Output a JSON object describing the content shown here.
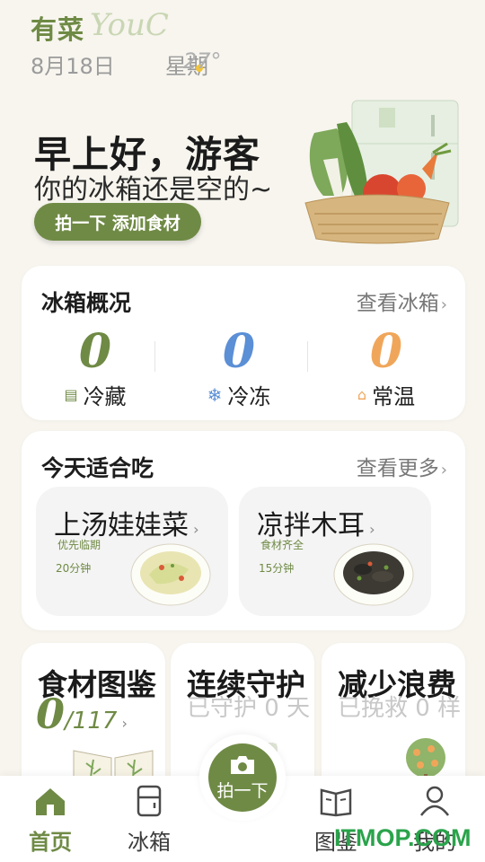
{
  "header": {
    "brand": "有菜",
    "brand_script": "YouC",
    "date": "8月18日",
    "weekday": "星期",
    "temperature": "27°"
  },
  "hero": {
    "greeting": "早上好，游客",
    "status": "你的冰箱还是空的~",
    "photo_button": "拍一下 添加食材"
  },
  "fridge": {
    "title": "冰箱概况",
    "link": "查看冰箱",
    "stats": [
      {
        "value": "0",
        "label": "冷藏",
        "icon": "fridge-icon",
        "color": "#6f8a45"
      },
      {
        "value": "0",
        "label": "冷冻",
        "icon": "snowflake-icon",
        "color": "#5b8fd6"
      },
      {
        "value": "0",
        "label": "常温",
        "icon": "house-icon",
        "color": "#f0a65a"
      }
    ]
  },
  "today": {
    "title": "今天适合吃",
    "link": "查看更多",
    "recipes": [
      {
        "name": "上汤娃娃菜",
        "tag": "优先临期",
        "time": "20分钟"
      },
      {
        "name": "凉拌木耳",
        "tag": "食材齐全",
        "time": "15分钟"
      }
    ]
  },
  "features": {
    "encyclopedia": {
      "title": "食材图鉴",
      "count": "0",
      "total": "/117"
    },
    "guard": {
      "title": "连续守护",
      "sub": "已守护 0 天"
    },
    "waste": {
      "title": "减少浪费",
      "sub": "已挽救 0 样"
    }
  },
  "tabbar": {
    "home": "首页",
    "fridge": "冰箱",
    "center": "拍一下",
    "guide": "图鉴",
    "mine": "我的"
  },
  "watermark": "ITMOP.COM",
  "colors": {
    "brand_green": "#6f8a45",
    "freeze_blue": "#5b8fd6",
    "room_orange": "#f0a65a",
    "background": "#f7f5ee"
  }
}
